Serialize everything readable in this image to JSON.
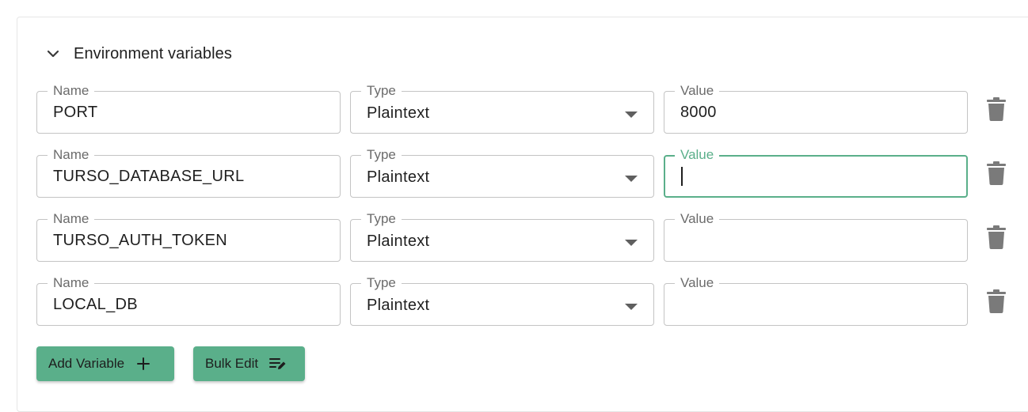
{
  "section": {
    "title": "Environment variables",
    "expanded": true
  },
  "rows": [
    {
      "name_label": "Name",
      "name": "PORT",
      "type_label": "Type",
      "type": "Plaintext",
      "value_label": "Value",
      "value": "8000"
    },
    {
      "name_label": "Name",
      "name": "TURSO_DATABASE_URL",
      "type_label": "Type",
      "type": "Plaintext",
      "value_label": "Value",
      "value": ""
    },
    {
      "name_label": "Name",
      "name": "TURSO_AUTH_TOKEN",
      "type_label": "Type",
      "type": "Plaintext",
      "value_label": "Value",
      "value": ""
    },
    {
      "name_label": "Name",
      "name": "LOCAL_DB",
      "type_label": "Type",
      "type": "Plaintext",
      "value_label": "Value",
      "value": ""
    }
  ],
  "buttons": {
    "add_variable": "Add Variable",
    "bulk_edit": "Bulk Edit"
  },
  "colors": {
    "accent": "#5aaf8a",
    "border": "#c4c4c4",
    "icon": "#7a7a7a"
  },
  "icons": {
    "chevron": "chevron-down-icon",
    "delete": "trash-icon",
    "add": "plus-icon",
    "bulk": "list-edit-icon"
  }
}
